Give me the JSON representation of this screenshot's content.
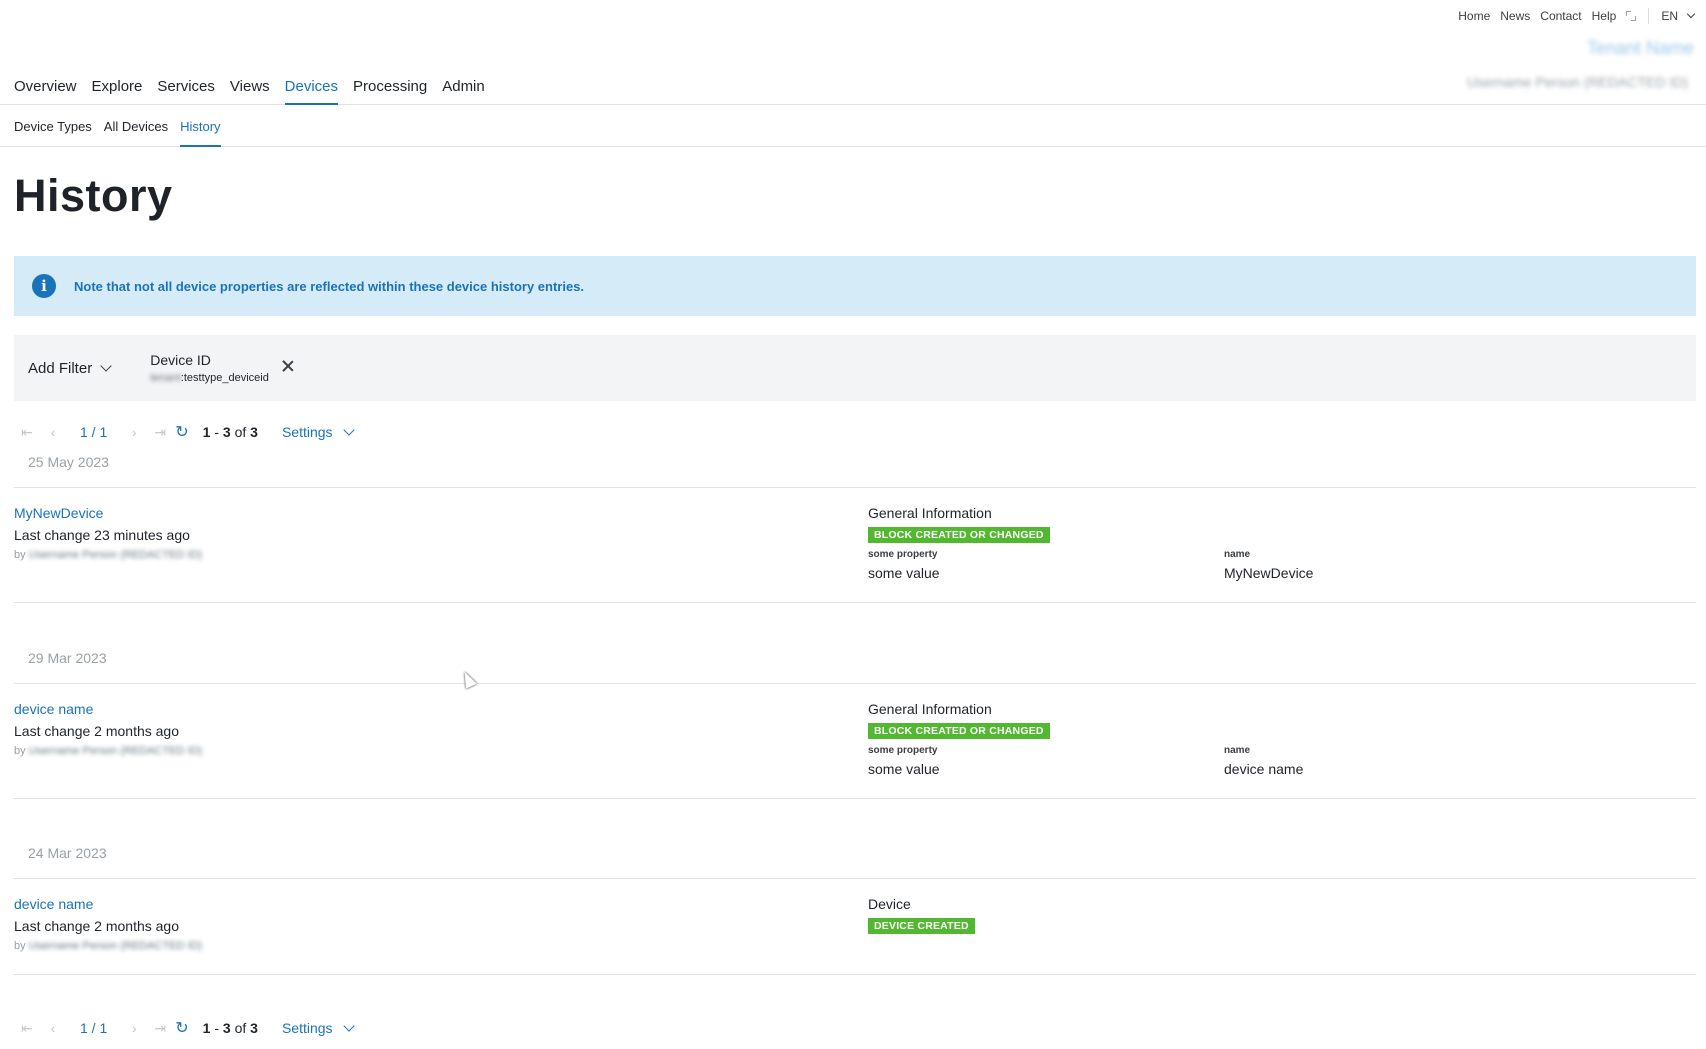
{
  "utility": {
    "links": [
      "Home",
      "News",
      "Contact",
      "Help"
    ],
    "language": "EN"
  },
  "tenant": "Tenant Name",
  "user": "Username Person (REDACTED ID)",
  "main_nav": [
    "Overview",
    "Explore",
    "Services",
    "Views",
    "Devices",
    "Processing",
    "Admin"
  ],
  "sub_nav": [
    "Device Types",
    "All Devices",
    "History"
  ],
  "page_title": "History",
  "info": "Note that not all device properties are reflected within these device history entries.",
  "filter": {
    "add_label": "Add Filter",
    "chip_label": "Device ID",
    "chip_value_prefix": "tenant",
    "chip_value": ":testtype_deviceid"
  },
  "pager": {
    "page": "1 / 1",
    "range_start": "1",
    "range_end": "3",
    "of_label": "of",
    "total": "3",
    "settings": "Settings"
  },
  "groups": [
    {
      "date": "25 May 2023",
      "device": "MyNewDevice",
      "last_change": "Last change 23 minutes ago",
      "by_label": "by",
      "by_user": "Username Person (REDACTED ID)",
      "section": "General Information",
      "badge": "BLOCK CREATED OR CHANGED",
      "props": [
        {
          "k": "some property",
          "v": "some value"
        },
        {
          "k": "name",
          "v": "MyNewDevice"
        }
      ]
    },
    {
      "date": "29 Mar 2023",
      "device": "device name",
      "last_change": "Last change 2 months ago",
      "by_label": "by",
      "by_user": "Username Person (REDACTED ID)",
      "section": "General Information",
      "badge": "BLOCK CREATED OR CHANGED",
      "props": [
        {
          "k": "some property",
          "v": "some value"
        },
        {
          "k": "name",
          "v": "device name"
        }
      ]
    },
    {
      "date": "24 Mar 2023",
      "device": "device name",
      "last_change": "Last change 2 months ago",
      "by_label": "by",
      "by_user": "Username Person (REDACTED ID)",
      "section": "Device",
      "badge": "DEVICE CREATED",
      "props": []
    }
  ],
  "colors": {
    "accent": "#1a73b8",
    "badge": "#52b830",
    "info_bg": "#d6ebf8"
  }
}
